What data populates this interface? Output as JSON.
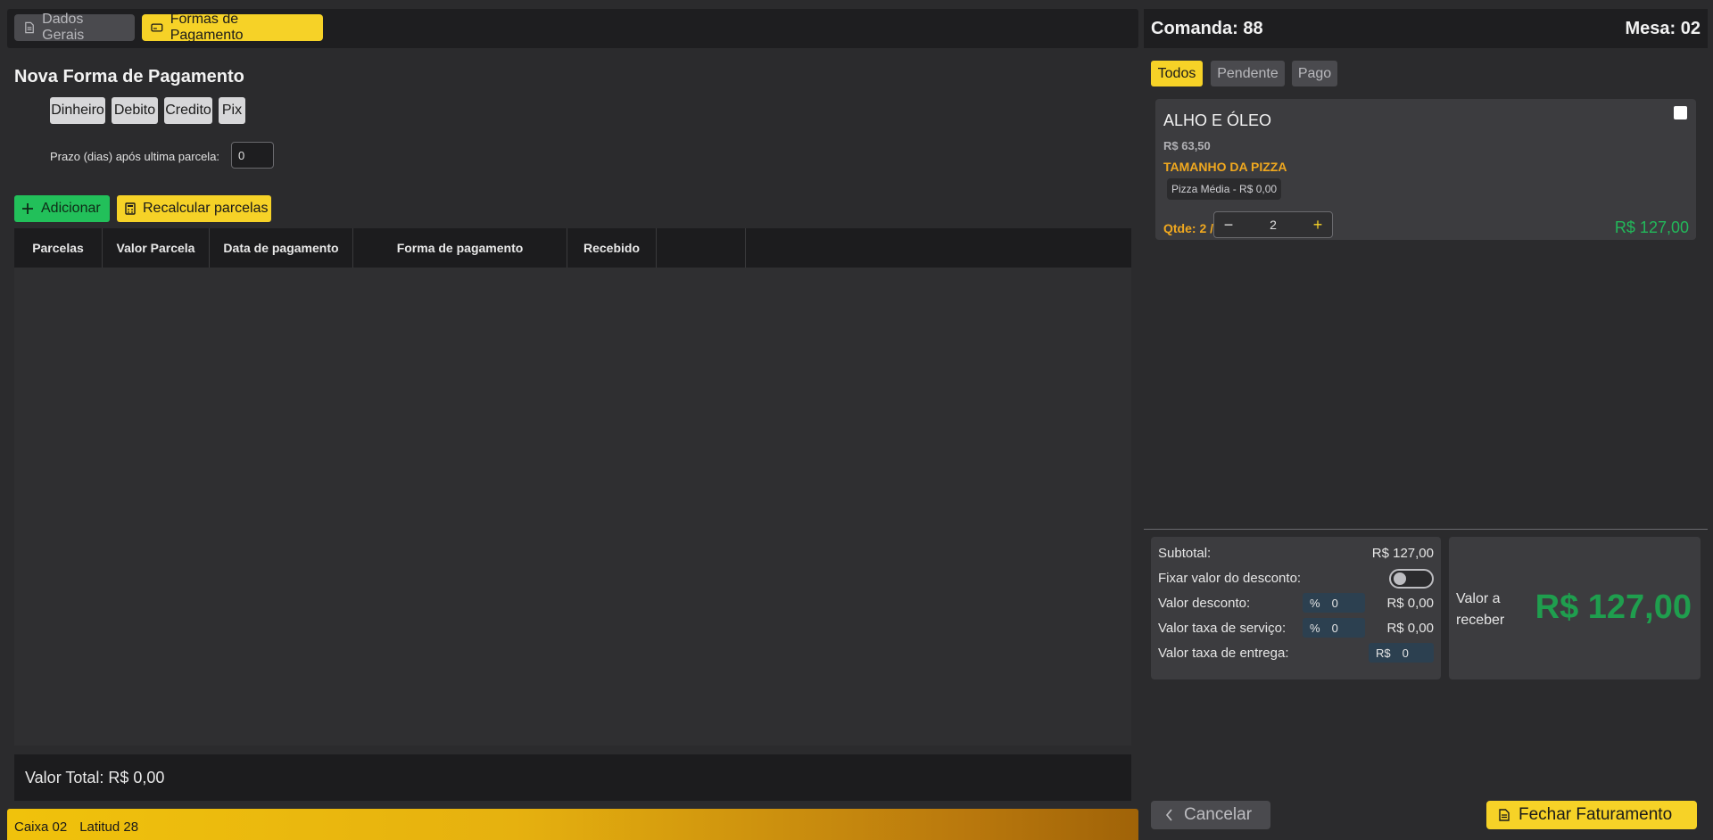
{
  "tabs": [
    {
      "label": "Dados Gerais",
      "icon": "document-icon"
    },
    {
      "label": "Formas de Pagamento",
      "icon": "card-icon"
    }
  ],
  "form": {
    "title": "Nova Forma de Pagamento",
    "payment_methods": [
      "Dinheiro",
      "Debito",
      "Credito",
      "Pix"
    ],
    "prazo_label": "Prazo (dias) após ultima parcela:",
    "prazo_value": "0"
  },
  "actions": {
    "add_label": "Adicionar",
    "recalc_label": "Recalcular parcelas"
  },
  "table": {
    "columns": [
      "Parcelas",
      "Valor Parcela",
      "Data de pagamento",
      "Forma de pagamento",
      "Recebido",
      ""
    ],
    "total_label": "Valor Total: R$ 0,00"
  },
  "status_bar": {
    "caixa": "Caixa 02",
    "user": "Latitud 28"
  },
  "order": {
    "comanda": "Comanda: 88",
    "mesa": "Mesa: 02",
    "filters": [
      "Todos",
      "Pendente",
      "Pago"
    ],
    "active_filter": "Todos",
    "item": {
      "name": "ALHO E ÓLEO",
      "unit_price": "R$ 63,50",
      "category": "TAMANHO DA PIZZA",
      "option": "Pizza Média - R$ 0,00",
      "qty_label": "Qtde: 2 /",
      "qty": "2",
      "total": "R$ 127,00"
    }
  },
  "summary": {
    "subtotal_label": "Subtotal:",
    "subtotal_value": "R$ 127,00",
    "fix_discount_label": "Fixar valor do desconto:",
    "fix_discount_on": false,
    "discount_label": "Valor desconto:",
    "discount_unit": "%",
    "discount_input": "0",
    "discount_value": "R$ 0,00",
    "service_label": "Valor taxa de serviço:",
    "service_unit": "%",
    "service_input": "0",
    "service_value": "R$ 0,00",
    "delivery_label": "Valor taxa de entrega:",
    "delivery_unit": "R$",
    "delivery_input": "0"
  },
  "receive": {
    "label": "Valor a receber",
    "value": "R$ 127,00"
  },
  "footer": {
    "cancel_label": "Cancelar",
    "close_label": "Fechar Faturamento"
  },
  "colors": {
    "accent_yellow": "#f6d227",
    "success_green": "#22c05a",
    "total_green": "#1f9e4e",
    "category_orange": "#f0a81f"
  }
}
